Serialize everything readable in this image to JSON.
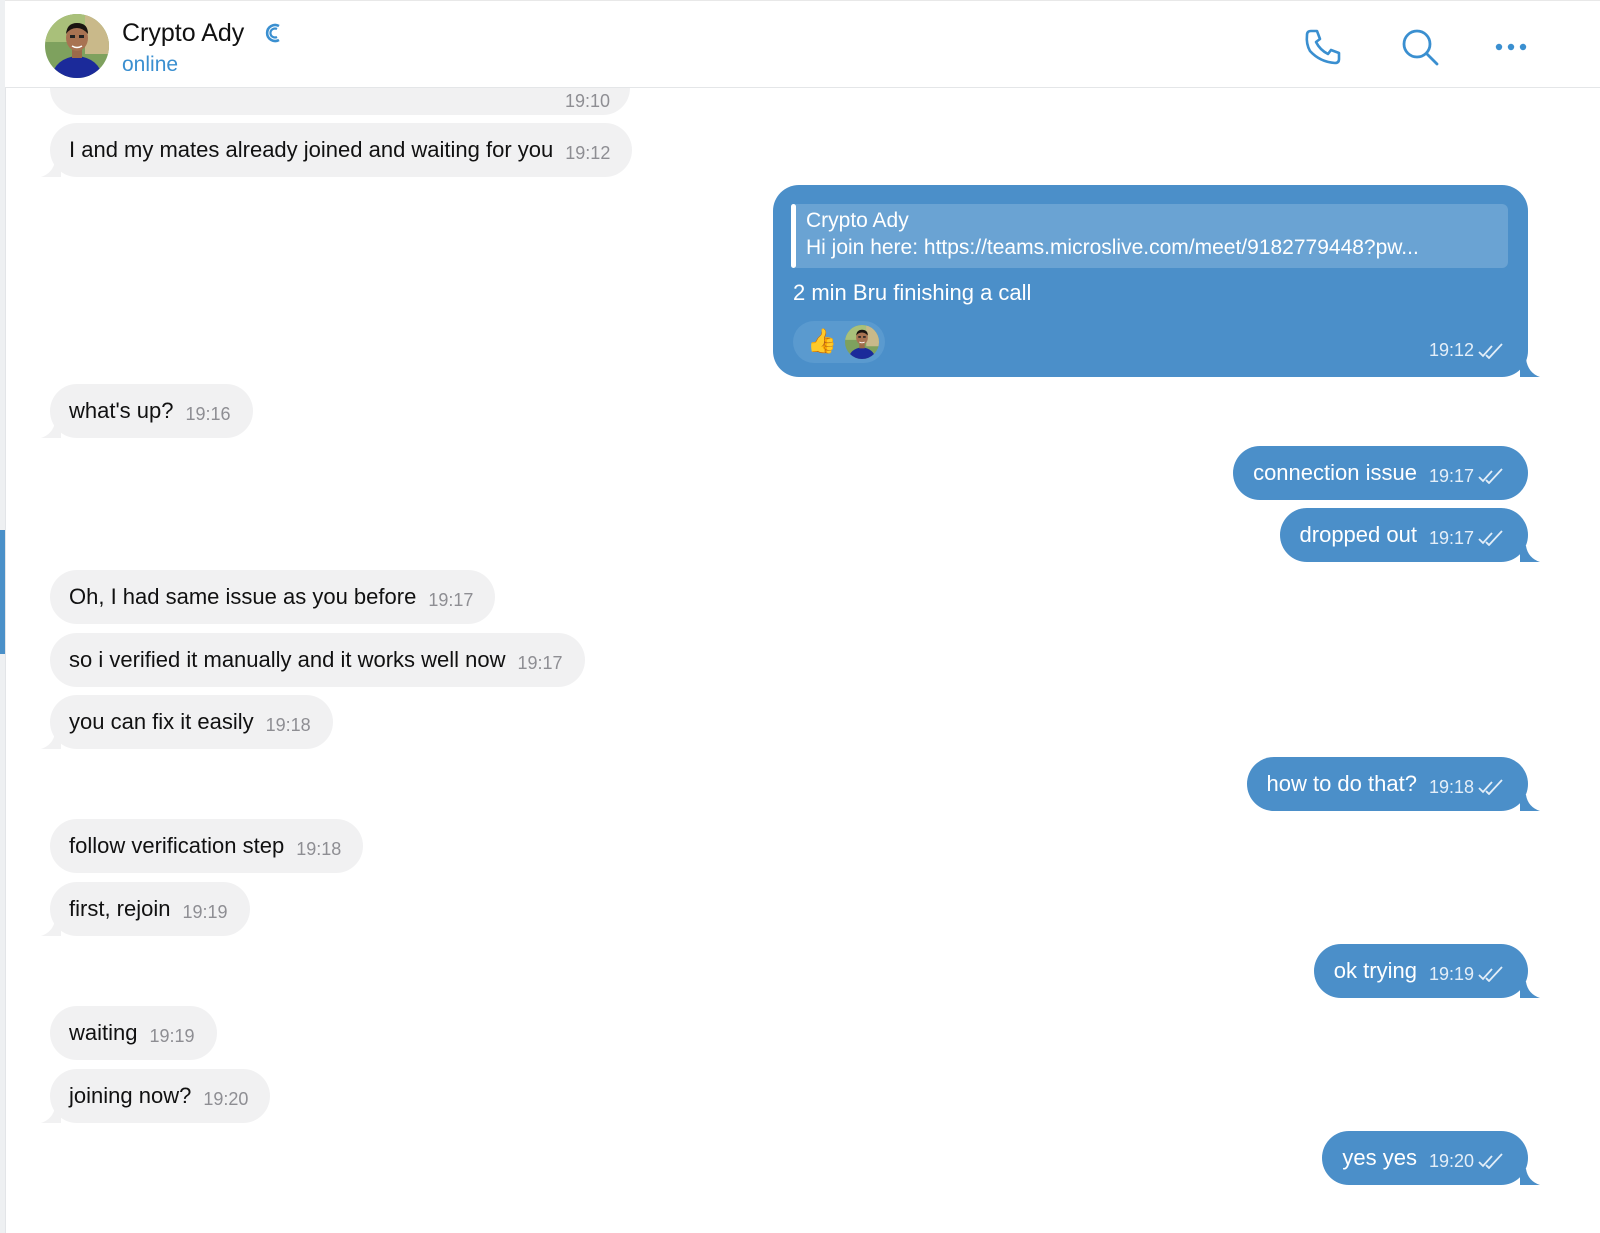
{
  "header": {
    "name": "Crypto Ady",
    "status": "online",
    "icons": [
      "phone-icon",
      "search-icon",
      "more-icon"
    ]
  },
  "colors": {
    "accent": "#3a8fd0",
    "outgoing": "#4b8fc9",
    "incoming": "#f1f1f2"
  },
  "top_partial": {
    "time": "19:10"
  },
  "messages": [
    {
      "dir": "in",
      "text": "I and my mates already joined and waiting for you",
      "time": "19:12"
    },
    {
      "dir": "in",
      "text": "what's up?",
      "time": "19:16"
    },
    {
      "dir": "out",
      "text": "connection issue",
      "time": "19:17"
    },
    {
      "dir": "out",
      "text": "dropped out",
      "time": "19:17"
    },
    {
      "dir": "in",
      "text": "Oh, I had same issue as you before",
      "time": "19:17"
    },
    {
      "dir": "in",
      "text": "so i verified it manually and it works well now",
      "time": "19:17"
    },
    {
      "dir": "in",
      "text": "you can fix it easily",
      "time": "19:18"
    },
    {
      "dir": "out",
      "text": "how to do that?",
      "time": "19:18"
    },
    {
      "dir": "in",
      "text": "follow verification step",
      "time": "19:18"
    },
    {
      "dir": "in",
      "text": "first, rejoin",
      "time": "19:19"
    },
    {
      "dir": "out",
      "text": "ok trying",
      "time": "19:19"
    },
    {
      "dir": "in",
      "text": "waiting",
      "time": "19:19"
    },
    {
      "dir": "in",
      "text": "joining now?",
      "time": "19:20"
    },
    {
      "dir": "out",
      "text": "yes yes",
      "time": "19:20"
    }
  ],
  "reply_message": {
    "quote_name": "Crypto Ady",
    "quote_text": "Hi join here: https://teams.microslive.com/meet/9182779448?pw...",
    "text": "2 min Bru finishing a call",
    "reaction": "👍",
    "time": "19:12"
  }
}
